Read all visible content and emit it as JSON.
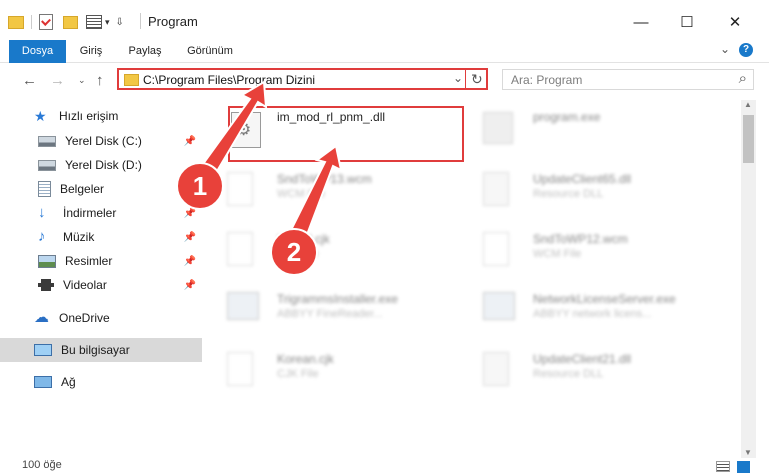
{
  "window": {
    "title": "Program",
    "minimize": "—",
    "maximize": "☐",
    "close": "✕"
  },
  "ribbon": {
    "tabs": [
      "Dosya",
      "Giriş",
      "Paylaş",
      "Görünüm"
    ],
    "expand": "⌄",
    "help": "?"
  },
  "address": {
    "path": "C:\\Program Files\\Program Dizini",
    "refresh": "↻",
    "dropdown": "⌄"
  },
  "search": {
    "placeholder": "Ara: Program",
    "icon": "⌕"
  },
  "nav": {
    "back": "←",
    "forward": "→",
    "up": "↑",
    "recent": "⌄"
  },
  "sidebar": {
    "items": [
      {
        "label": "Hızlı erişim",
        "icon": "star-icon",
        "pinned": false
      },
      {
        "label": "Yerel Disk (C:)",
        "icon": "drive-icon",
        "pinned": true
      },
      {
        "label": "Yerel Disk (D:)",
        "icon": "drive-icon",
        "pinned": false
      },
      {
        "label": "Belgeler",
        "icon": "document-icon",
        "pinned": true
      },
      {
        "label": "İndirmeler",
        "icon": "download-icon",
        "pinned": true
      },
      {
        "label": "Müzik",
        "icon": "music-icon",
        "pinned": true
      },
      {
        "label": "Resimler",
        "icon": "pictures-icon",
        "pinned": true
      },
      {
        "label": "Videolar",
        "icon": "video-icon",
        "pinned": true
      },
      {
        "label": "OneDrive",
        "icon": "cloud-icon",
        "pinned": false
      },
      {
        "label": "Bu bilgisayar",
        "icon": "computer-icon",
        "pinned": false
      },
      {
        "label": "Ağ",
        "icon": "network-icon",
        "pinned": false
      }
    ],
    "pin_glyph": "📌"
  },
  "files": [
    {
      "name": "im_mod_rl_pnm_.dll",
      "type": ""
    },
    {
      "name": "program.exe",
      "type": ""
    },
    {
      "name": "SndToWP13.wcm",
      "type": "WCM File"
    },
    {
      "name": "UpdateClient65.dll",
      "type": "Resource DLL"
    },
    {
      "name": "Kernel.cjk",
      "type": "CJK File"
    },
    {
      "name": "SndToWP12.wcm",
      "type": "WCM File"
    },
    {
      "name": "TrigrammsInstaller.exe",
      "type": "ABBYY FineReader..."
    },
    {
      "name": "NetworkLicenseServer.exe",
      "type": "ABBYY network licens..."
    },
    {
      "name": "Korean.cjk",
      "type": "CJK File"
    },
    {
      "name": "UpdateClient21.dll",
      "type": "Resource DLL"
    }
  ],
  "status": {
    "count": "100 öğe"
  },
  "annotations": {
    "step1": "1",
    "step2": "2"
  },
  "colors": {
    "accent": "#1979ca",
    "highlight": "#e03c3c",
    "selected": "#d9d9d9"
  }
}
